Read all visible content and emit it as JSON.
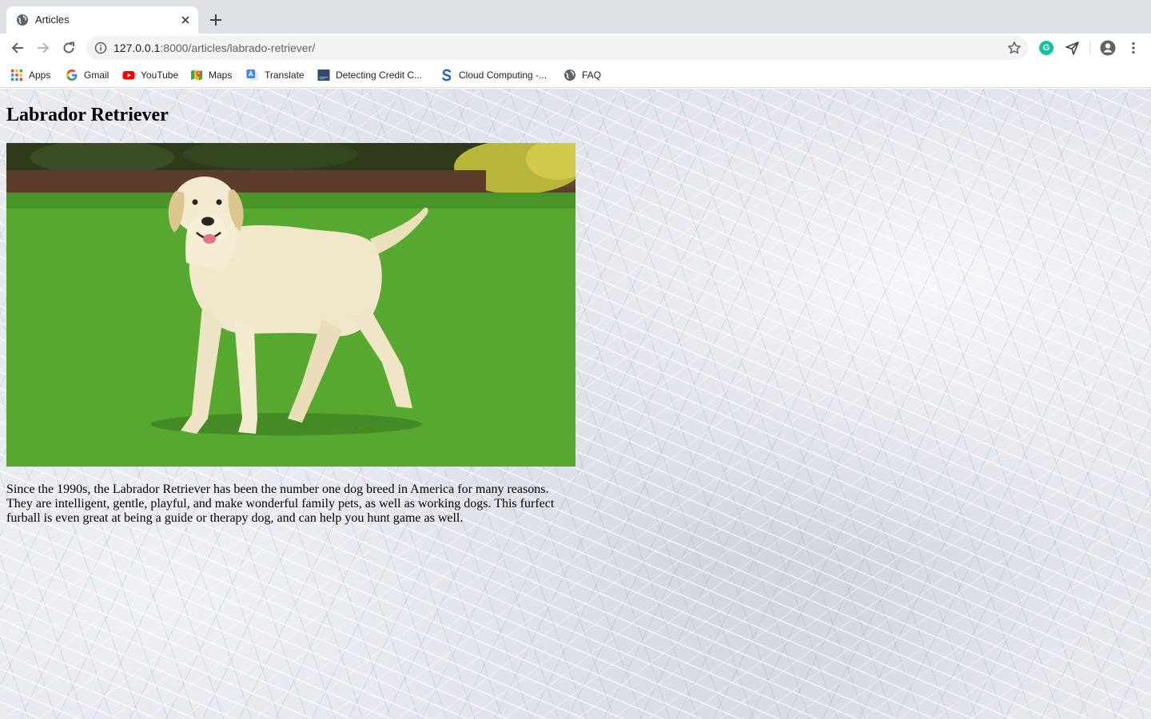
{
  "browser": {
    "tab": {
      "title": "Articles"
    },
    "address_bar": {
      "url_host": "127.0.0.1",
      "url_path": ":8000/articles/labrado-retriever/"
    },
    "bookmarks": [
      {
        "label": "Apps",
        "icon": "apps-grid-icon"
      },
      {
        "label": "Gmail",
        "icon": "google-icon"
      },
      {
        "label": "YouTube",
        "icon": "youtube-icon"
      },
      {
        "label": "Maps",
        "icon": "maps-icon"
      },
      {
        "label": "Translate",
        "icon": "translate-icon"
      },
      {
        "label": "Detecting Credit C...",
        "icon": "document-icon"
      },
      {
        "label": "Cloud Computing -...",
        "icon": "s-logo-icon"
      },
      {
        "label": "FAQ",
        "icon": "globe-icon"
      }
    ],
    "extensions": [
      {
        "name": "grammarly-icon",
        "glyph": "G"
      },
      {
        "name": "send-icon"
      }
    ]
  },
  "article": {
    "title": "Labrador Retriever",
    "image_alt": "Labrador Retriever standing on grass",
    "body": "Since the 1990s, the Labrador Retriever has been the number one dog breed in America for many reasons. They are intelligent, gentle, playful, and make wonderful family pets, as well as working dogs. This furfect furball is even great at being a guide or therapy dog, and can help you hunt game as well."
  },
  "colors": {
    "tab_strip": "#dee1e6",
    "omnibox": "#f1f3f4",
    "grammarly": "#15c39a",
    "youtube": "#ff0000"
  }
}
